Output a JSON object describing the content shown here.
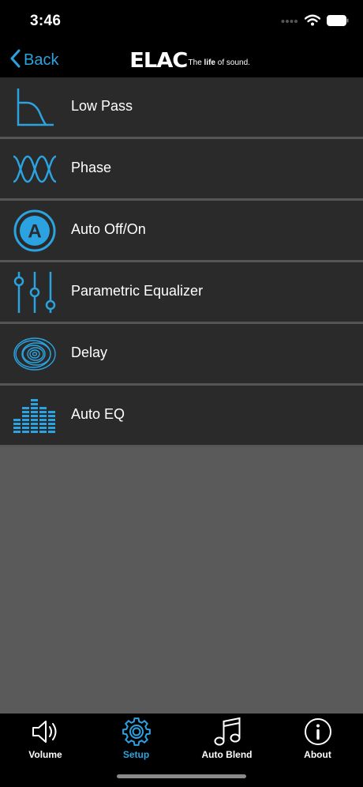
{
  "status_bar": {
    "time": "3:46"
  },
  "nav": {
    "back_label": "Back",
    "logo_text": "ELAC",
    "logo_tagline_prefix": "The ",
    "logo_tagline_bold": "life",
    "logo_tagline_suffix": " of sound."
  },
  "menu": {
    "items": [
      {
        "label": "Low Pass",
        "icon": "low-pass-filter-icon"
      },
      {
        "label": "Phase",
        "icon": "phase-wave-icon"
      },
      {
        "label": "Auto Off/On",
        "icon": "auto-a-circle-icon"
      },
      {
        "label": "Parametric Equalizer",
        "icon": "equalizer-sliders-icon"
      },
      {
        "label": "Delay",
        "icon": "delay-ripple-icon"
      },
      {
        "label": "Auto EQ",
        "icon": "auto-eq-bars-icon"
      }
    ]
  },
  "tabs": {
    "items": [
      {
        "label": "Volume",
        "icon": "speaker-icon"
      },
      {
        "label": "Setup",
        "icon": "gear-icon"
      },
      {
        "label": "Auto Blend",
        "icon": "music-note-icon"
      },
      {
        "label": "About",
        "icon": "info-icon"
      }
    ],
    "active_index": 1
  },
  "colors": {
    "accent": "#2aa3e0",
    "item_bg": "#2a2a2a",
    "background": "#5a5a5a"
  }
}
